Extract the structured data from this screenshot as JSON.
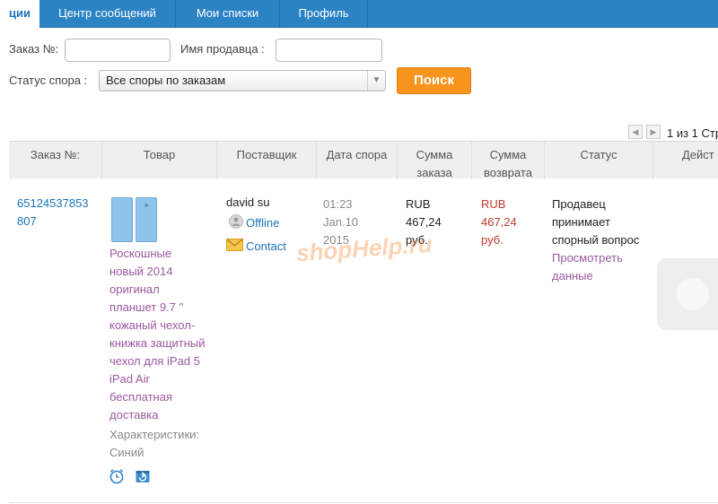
{
  "nav": {
    "tabs": [
      {
        "label": "ции"
      },
      {
        "label": "Центр сообщений"
      },
      {
        "label": "Мои списки"
      },
      {
        "label": "Профиль"
      }
    ]
  },
  "search": {
    "order_label": "Заказ №:",
    "order_value": "",
    "seller_label": "Имя продавца :",
    "seller_value": "",
    "status_label": "Статус спора :",
    "status_selected": "Все споры по заказам",
    "search_button": "Поиск"
  },
  "pager": {
    "prev_icon": "chevron-left-icon",
    "next_icon": "chevron-right-icon",
    "text": "1 из 1 Стр"
  },
  "table": {
    "headers": {
      "order": "Заказ №:",
      "product": "Товар",
      "supplier": "Поставщик",
      "dispute_date": "Дата спора",
      "order_sum_1": "Сумма",
      "order_sum_2": "заказа",
      "refund_sum_1": "Сумма",
      "refund_sum_2": "возврата",
      "status": "Статус",
      "actions": "Дейст"
    },
    "row": {
      "order_id_1": "65124537853",
      "order_id_2": "807",
      "product_lines": [
        "Роскошные",
        "новый 2014",
        "оригинал",
        "планшет 9.7 ''",
        "кожаный чехол-",
        "книжка защитный",
        "чехол для iPad 5",
        "iPad Air",
        "бесплатная",
        "доставка"
      ],
      "specs_label": "Характеристики:",
      "specs_value": "Синий",
      "supplier_name": "david su",
      "supplier_status": "Offline",
      "contact": "Contact",
      "date_time": "01:23",
      "date_day": "Jan.10",
      "date_year": "2015",
      "order_sum": [
        "RUB",
        "467,24",
        "руб."
      ],
      "refund_sum": [
        "RUB",
        "467,24",
        "руб."
      ],
      "status_lines": [
        "Продавец",
        "принимает",
        "спорный вопрос"
      ],
      "view_link": [
        "Просмотреть",
        "данные"
      ]
    }
  },
  "watermark": "shopHelp.ru",
  "colors": {
    "nav_blue": "#2b83c4",
    "link_blue": "#1a73b8",
    "accent_orange": "#f7941d",
    "product_purple": "#9b59a0",
    "refund_red": "#c0392b"
  }
}
